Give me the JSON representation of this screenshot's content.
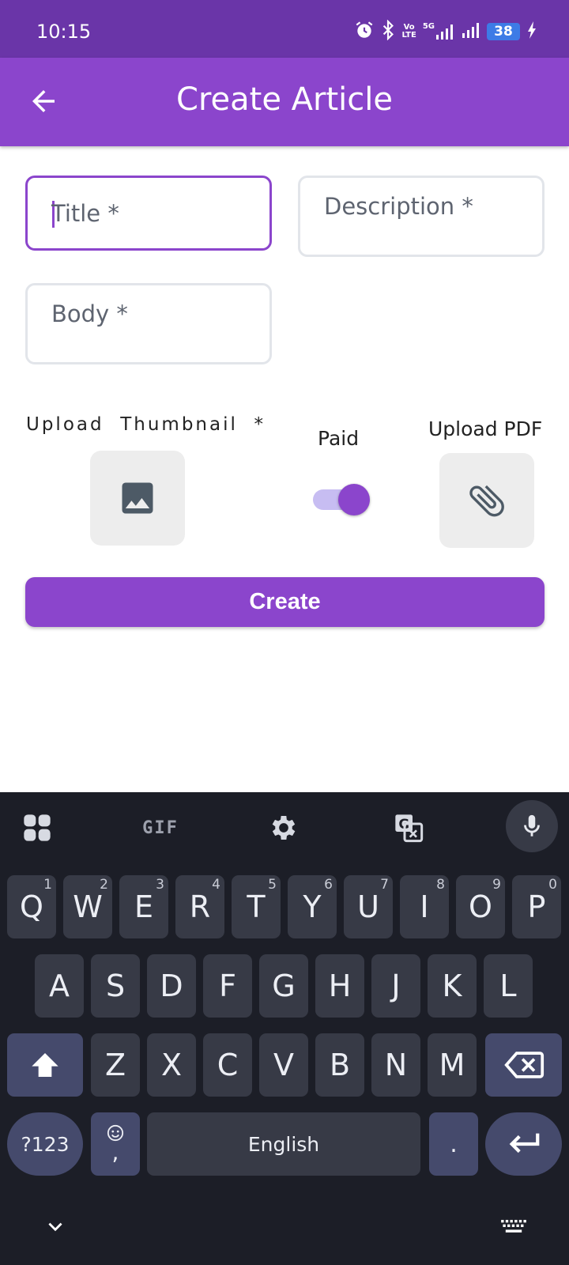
{
  "status_bar": {
    "time": "10:15",
    "volte_top": "Vo",
    "volte_bottom": "LTE",
    "network": "5G",
    "battery": "38"
  },
  "app_bar": {
    "title": "Create Article",
    "back_icon": "arrow-back-icon"
  },
  "form": {
    "title_placeholder": "Title *",
    "description_placeholder": "Description *",
    "body_placeholder": "Body *",
    "upload_thumbnail_label": "Upload  Thumbnail  *",
    "paid_label": "Paid",
    "paid_on": true,
    "upload_pdf_label": "Upload PDF",
    "thumbnail_icon": "image-icon",
    "pdf_icon": "attachment-icon",
    "create_button": "Create"
  },
  "keyboard": {
    "toolbar": [
      "apps-grid-icon",
      "gif-icon",
      "settings-icon",
      "translate-icon",
      "mic-icon"
    ],
    "gif_label": "GIF",
    "row1": [
      {
        "key": "Q",
        "hint": "1"
      },
      {
        "key": "W",
        "hint": "2"
      },
      {
        "key": "E",
        "hint": "3"
      },
      {
        "key": "R",
        "hint": "4"
      },
      {
        "key": "T",
        "hint": "5"
      },
      {
        "key": "Y",
        "hint": "6"
      },
      {
        "key": "U",
        "hint": "7"
      },
      {
        "key": "I",
        "hint": "8"
      },
      {
        "key": "O",
        "hint": "9"
      },
      {
        "key": "P",
        "hint": "0"
      }
    ],
    "row2": [
      "A",
      "S",
      "D",
      "F",
      "G",
      "H",
      "J",
      "K",
      "L"
    ],
    "row3": [
      "Z",
      "X",
      "C",
      "V",
      "B",
      "N",
      "M"
    ],
    "symbols_key": "?123",
    "emoji_comma_key": ",",
    "space_key": "English",
    "period_key": ".",
    "colors": {
      "accent": "#8b45cc",
      "status_bar": "#6a35a8",
      "keyboard_bg": "#1c1e27",
      "key": "#373a46",
      "function_key": "#454a6c"
    }
  }
}
